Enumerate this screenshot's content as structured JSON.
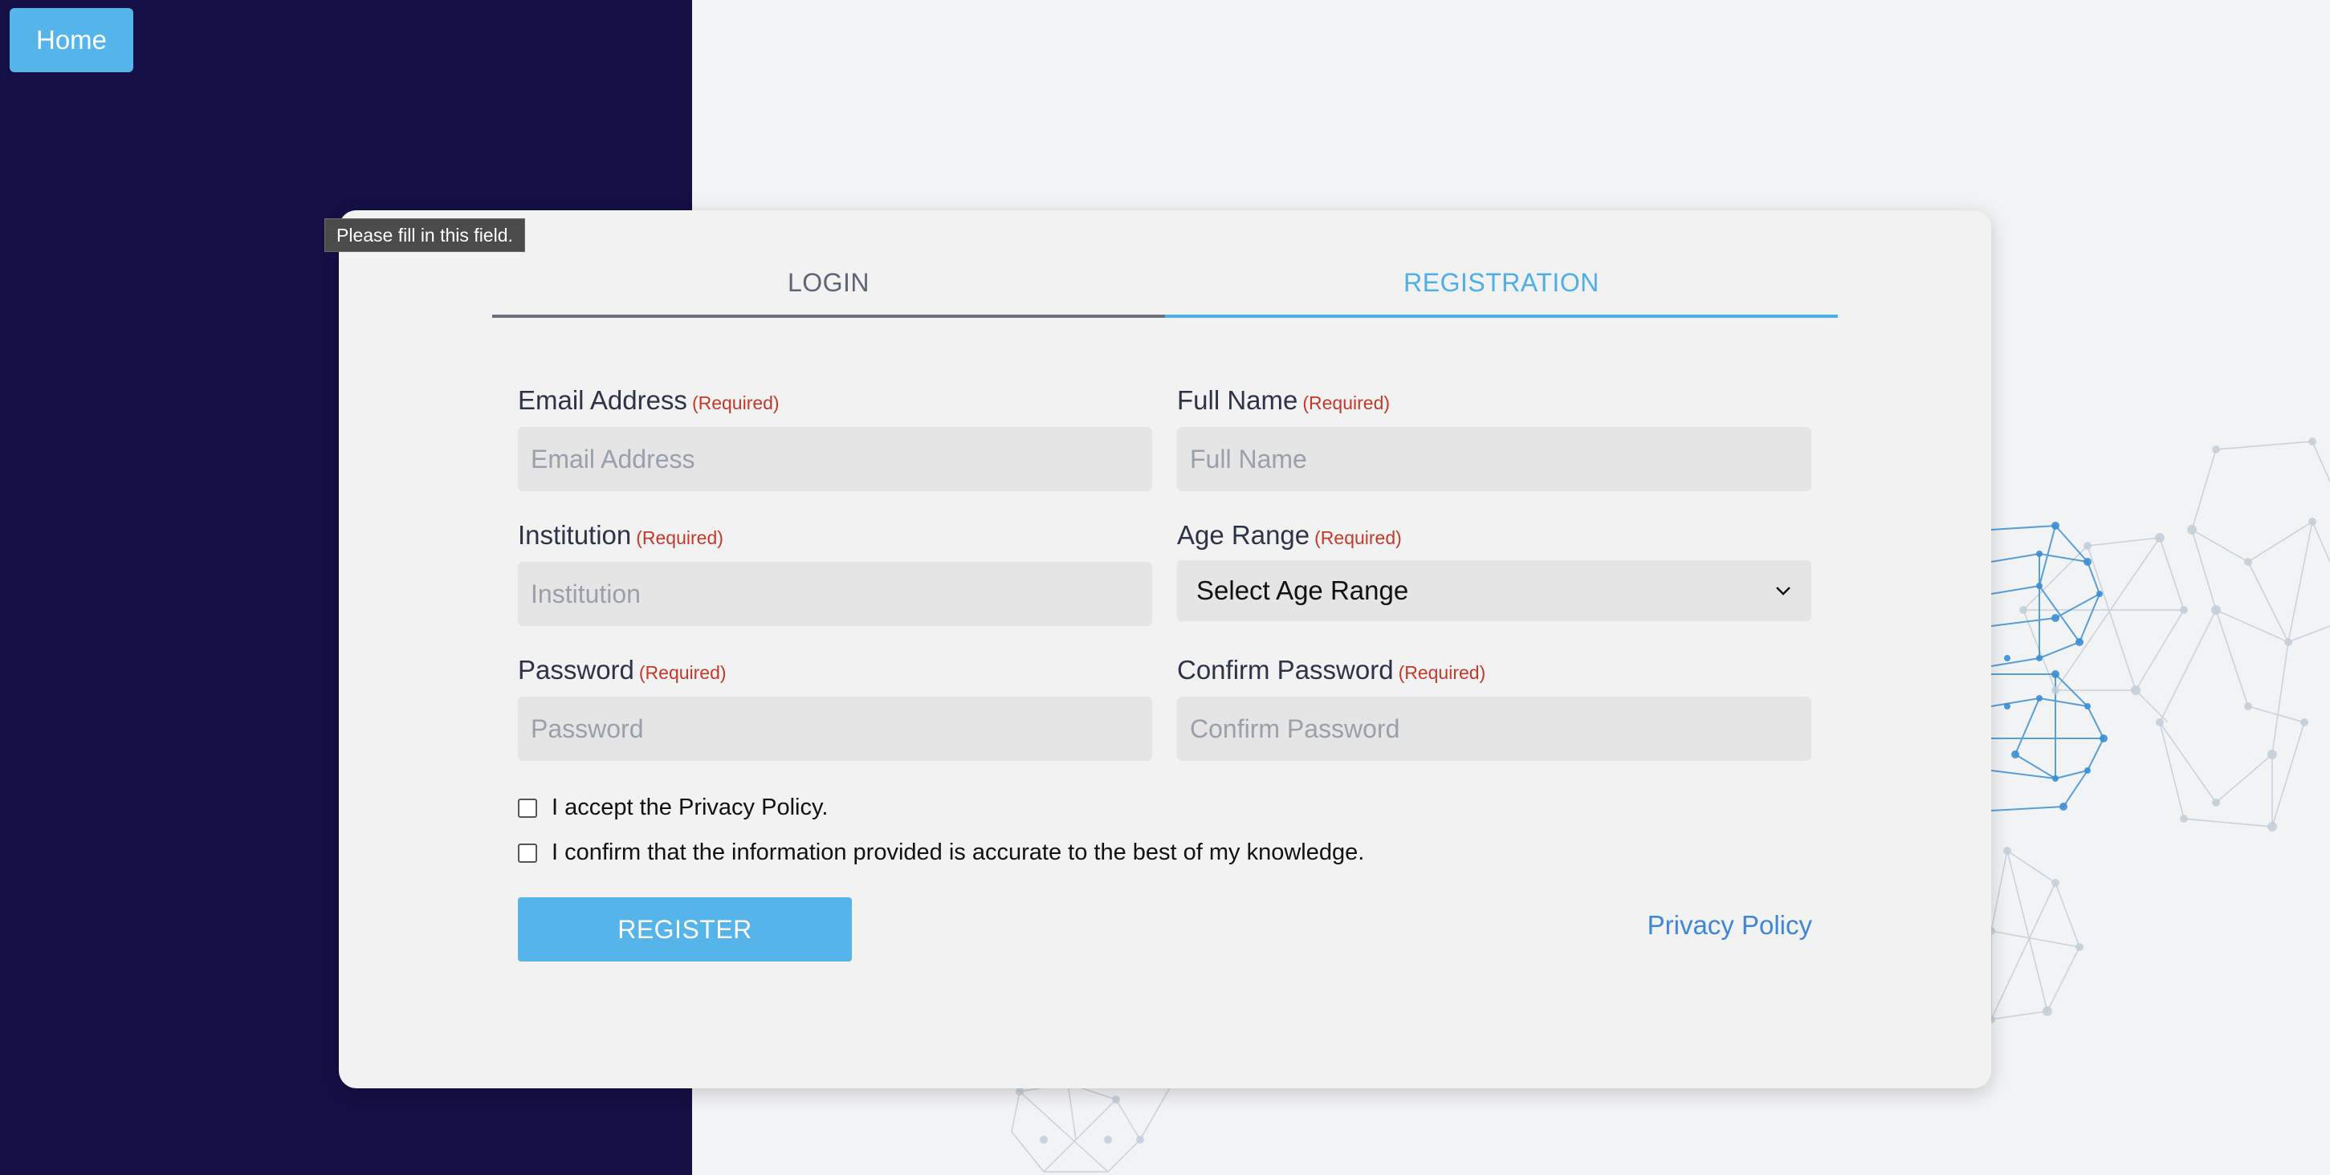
{
  "home_button": {
    "label": "Home"
  },
  "tooltip": {
    "text": "Please fill in this field."
  },
  "tabs": [
    {
      "label": "LOGIN",
      "active": false
    },
    {
      "label": "REGISTRATION",
      "active": true
    }
  ],
  "form": {
    "required_tag": "(Required)",
    "email": {
      "label": "Email Address",
      "placeholder": "Email Address",
      "value": ""
    },
    "full_name": {
      "label": "Full Name",
      "placeholder": "Full Name",
      "value": ""
    },
    "institution": {
      "label": "Institution",
      "placeholder": "Institution",
      "value": ""
    },
    "age_range": {
      "label": "Age Range",
      "selected": "Select Age Range"
    },
    "password": {
      "label": "Password",
      "placeholder": "Password",
      "value": ""
    },
    "confirm_password": {
      "label": "Confirm Password",
      "placeholder": "Confirm Password",
      "value": ""
    },
    "checkboxes": [
      {
        "label": "I accept the Privacy Policy.",
        "checked": false
      },
      {
        "label": "I confirm that the information provided is accurate to the best of my knowledge.",
        "checked": false
      }
    ],
    "register_label": "REGISTER",
    "privacy_link": "Privacy Policy"
  },
  "colors": {
    "sidebar": "#140f44",
    "accent": "#55b4ea",
    "required": "#c23a2a",
    "link": "#3f86d8",
    "page_bg": "#f2f3f5"
  },
  "icons": {
    "select_chevron": "chevron-down-icon",
    "background": "network-graph-decoration"
  }
}
